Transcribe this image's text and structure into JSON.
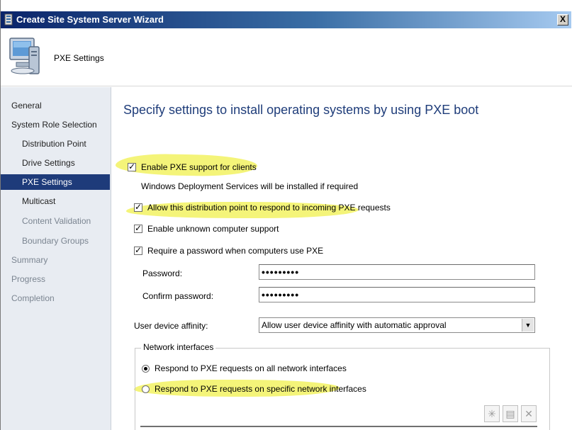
{
  "window": {
    "title": "Create Site System Server Wizard",
    "close_glyph": "X"
  },
  "header": {
    "title": "PXE Settings",
    "icon": "computer-monitor-icon"
  },
  "sidebar": {
    "items": [
      {
        "label": "General"
      },
      {
        "label": "System Role Selection"
      },
      {
        "label": "Distribution Point"
      },
      {
        "label": "Drive Settings"
      },
      {
        "label": "PXE Settings"
      },
      {
        "label": "Multicast"
      },
      {
        "label": "Content Validation"
      },
      {
        "label": "Boundary Groups"
      },
      {
        "label": "Summary"
      },
      {
        "label": "Progress"
      },
      {
        "label": "Completion"
      }
    ],
    "active_item": "PXE Settings"
  },
  "main": {
    "heading": "Specify settings to install operating systems by using PXE boot",
    "enable_pxe": {
      "label": "Enable PXE support for clients",
      "checked": true
    },
    "wds_note": "Windows Deployment Services will be installed if required",
    "allow_respond": {
      "label": "Allow this distribution point to respond to incoming PXE requests",
      "checked": true
    },
    "unknown_support": {
      "label": "Enable unknown computer support",
      "checked": true
    },
    "require_password": {
      "label": "Require a password when computers use PXE",
      "checked": true
    },
    "password": {
      "label": "Password:",
      "value": "•••••••••"
    },
    "confirm_password": {
      "label": "Confirm password:",
      "value": "•••••••••"
    },
    "user_affinity": {
      "label": "User device affinity:",
      "value": "Allow user device affinity with automatic approval"
    },
    "network_interfaces": {
      "title": "Network interfaces",
      "options": [
        {
          "label": "Respond to PXE requests on all network interfaces",
          "selected": true
        },
        {
          "label": "Respond to PXE requests on specific network interfaces",
          "selected": false
        }
      ]
    },
    "check_glyph": "✓",
    "dropdown_glyph": "▼",
    "toolbar": {
      "add_glyph": "✳",
      "properties_glyph": "▤",
      "delete_glyph": "✕"
    }
  },
  "colors": {
    "highlight": "#f3f36a",
    "active_nav": "#1e3b7a",
    "heading": "#1f3d7a"
  }
}
